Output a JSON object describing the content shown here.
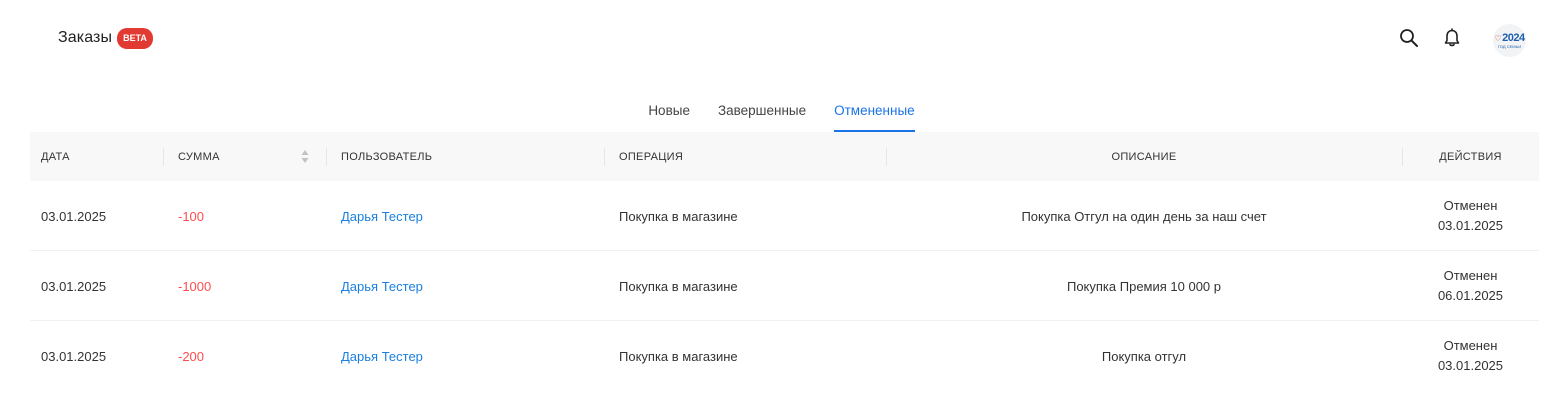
{
  "header": {
    "title": "Заказы",
    "badge": "BETA",
    "avatar_year": "2024",
    "avatar_caption": "ГОД СЕМЬИ"
  },
  "icons": {
    "search": "search-icon",
    "notifications": "bell-icon",
    "sort": "sort-icon"
  },
  "tabs": [
    {
      "label": "Новые",
      "active": false
    },
    {
      "label": "Завершенные",
      "active": false
    },
    {
      "label": "Отмененные",
      "active": true
    }
  ],
  "table": {
    "columns": {
      "date": "ДАТА",
      "amount": "СУММА",
      "user": "ПОЛЬЗОВАТЕЛЬ",
      "operation": "ОПЕРАЦИЯ",
      "description": "ОПИСАНИЕ",
      "actions": "ДЕЙСТВИЯ"
    },
    "rows": [
      {
        "date": "03.01.2025",
        "amount": "-100",
        "user": "Дарья Тестер",
        "operation": "Покупка в магазине",
        "description": "Покупка Отгул на один день за наш счет",
        "status": "Отменен",
        "status_date": "03.01.2025"
      },
      {
        "date": "03.01.2025",
        "amount": "-1000",
        "user": "Дарья Тестер",
        "operation": "Покупка в магазине",
        "description": "Покупка Премия 10 000 р",
        "status": "Отменен",
        "status_date": "06.01.2025"
      },
      {
        "date": "03.01.2025",
        "amount": "-200",
        "user": "Дарья Тестер",
        "operation": "Покупка в магазине",
        "description": "Покупка отгул",
        "status": "Отменен",
        "status_date": "03.01.2025"
      }
    ]
  },
  "colors": {
    "accent": "#1a73e8",
    "link": "#1a7fe0",
    "negative": "#ff4d4f",
    "badge": "#e03a33",
    "header_bg": "#f8f8f8"
  }
}
